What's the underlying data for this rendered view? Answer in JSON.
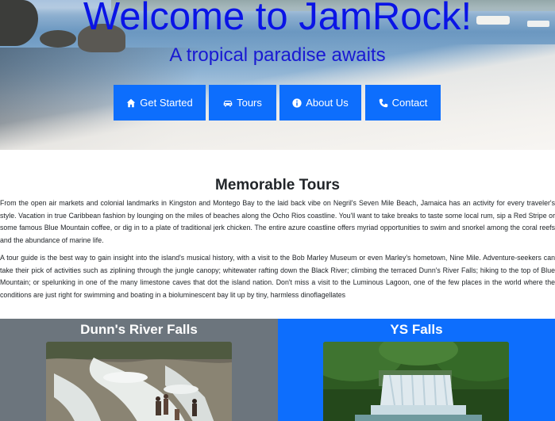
{
  "hero": {
    "title": "Welcome to JamRock!",
    "subtitle": "A tropical paradise awaits",
    "buttons": [
      {
        "icon": "home-icon",
        "label": "Get Started"
      },
      {
        "icon": "car-icon",
        "label": "Tours"
      },
      {
        "icon": "info-circle-icon",
        "label": "About Us"
      },
      {
        "icon": "phone-icon",
        "label": "Contact"
      }
    ]
  },
  "tours": {
    "heading": "Memorable Tours",
    "paragraphs": [
      "From the open air markets and colonial landmarks in Kingston and Montego Bay to the laid back vibe on Negril's Seven Mile Beach, Jamaica has an activity for every traveler's style. Vacation in true Caribbean fashion by lounging on the miles of beaches along the Ocho Rios coastline. You'll want to take breaks to taste some local rum, sip a Red Stripe or some famous Blue Mountain coffee, or dig in to a plate of traditional jerk chicken. The entire azure coastline offers myriad opportunities to swim and snorkel among the coral reefs and the abundance of marine life.",
      "A tour guide is the best way to gain insight into the island's musical history, with a visit to the Bob Marley Museum or even Marley's hometown, Nine Mile. Adventure-seekers can take their pick of activities such as ziplining through the jungle canopy; whitewater rafting down the Black River; climbing the terraced Dunn's River Falls; hiking to the top of Blue Mountain; or spelunking in one of the many limestone caves that dot the island nation. Don't miss a visit to the Luminous Lagoon, one of the few places in the world where the conditions are just right for swimming and boating in a bioluminescent bay lit up by tiny, harmless dinoflagellates"
    ]
  },
  "cards": [
    {
      "title": "Dunn's River Falls",
      "color": "#6c757d"
    },
    {
      "title": "YS Falls",
      "color": "#0d6efd"
    }
  ],
  "colors": {
    "title": "#0a14e6",
    "button": "#0d6efd",
    "card_gray": "#6c757d",
    "card_blue": "#0d6efd"
  }
}
